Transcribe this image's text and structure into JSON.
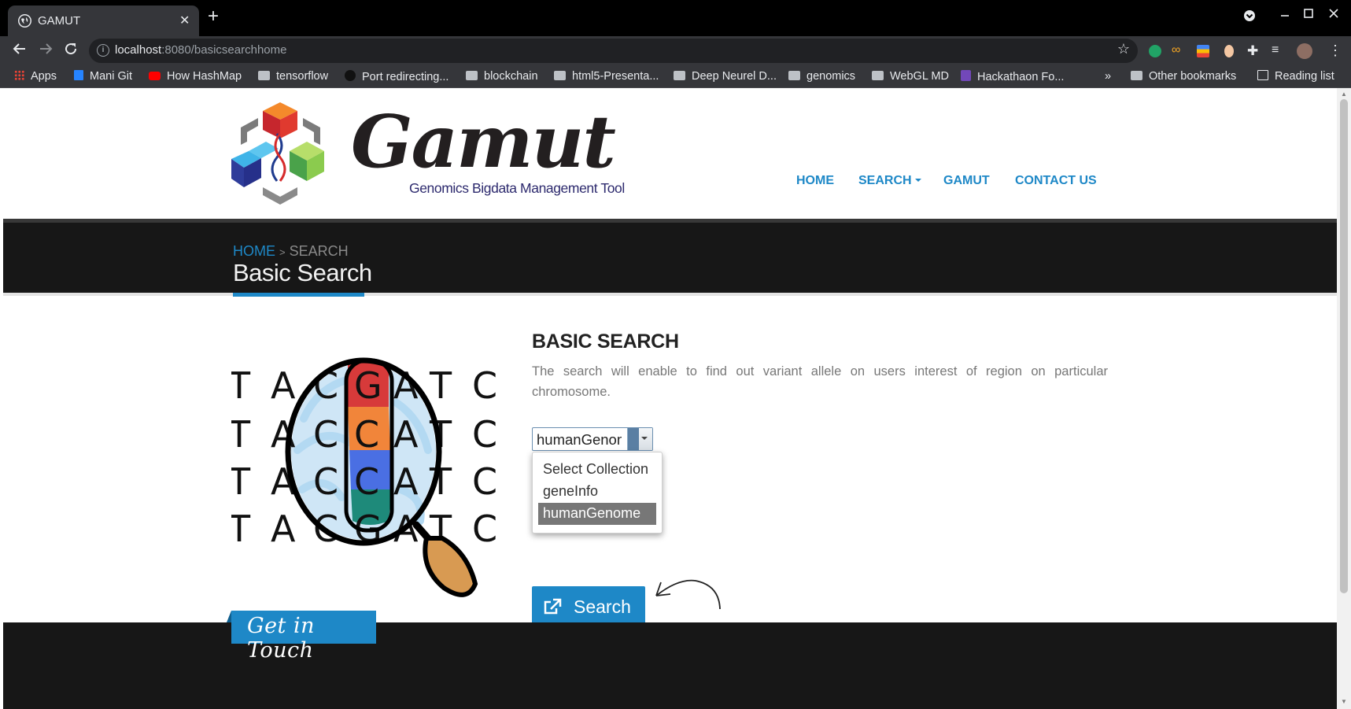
{
  "browser": {
    "tab_title": "GAMUT",
    "tab_close": "✕",
    "new_tab": "+",
    "url_host": "localhost",
    "url_path": ":8080/basicsearchhome",
    "bookmarks": [
      {
        "label": "Apps",
        "icon": "apps-grid-icon"
      },
      {
        "label": "Mani Git",
        "icon": "bitbucket-icon"
      },
      {
        "label": "How HashMap",
        "icon": "youtube-icon"
      },
      {
        "label": "tensorflow",
        "icon": "folder-icon"
      },
      {
        "label": "Port redirecting...",
        "icon": "github-icon"
      },
      {
        "label": "blockchain",
        "icon": "folder-icon"
      },
      {
        "label": "html5-Presenta...",
        "icon": "folder-icon"
      },
      {
        "label": "Deep Neurel D...",
        "icon": "folder-icon"
      },
      {
        "label": "genomics",
        "icon": "folder-icon"
      },
      {
        "label": "WebGL MD",
        "icon": "folder-icon"
      },
      {
        "label": "Hackathaon Fo...",
        "icon": "forms-icon"
      }
    ],
    "overflow": "»",
    "other_bookmarks": "Other bookmarks",
    "reading_list": "Reading list"
  },
  "site": {
    "brand": "Gamut",
    "tagline": "Genomics Bigdata Management Tool",
    "nav": {
      "home": "HOME",
      "search": "SEARCH",
      "gamut": "GAMUT",
      "contact": "CONTACT US"
    },
    "colors": {
      "accent": "#1e88c7",
      "banner": "#171717"
    }
  },
  "breadcrumb": {
    "home": "HOME",
    "separator": ">",
    "current": "SEARCH"
  },
  "page_title": "Basic Search",
  "illustration": {
    "sequence": [
      "T",
      "A",
      "C",
      "G",
      "A",
      "T",
      "C"
    ]
  },
  "basic_search": {
    "heading": "BASIC SEARCH",
    "description": "The search will enable to find out variant allele on users interest of region on particular chromosome.",
    "select_value": "humanGenome",
    "options": [
      "Select Collection",
      "geneInfo",
      "humanGenome"
    ],
    "selected_index": 2,
    "search_button": "Search"
  },
  "footer": {
    "get_in_touch": "Get in Touch"
  }
}
